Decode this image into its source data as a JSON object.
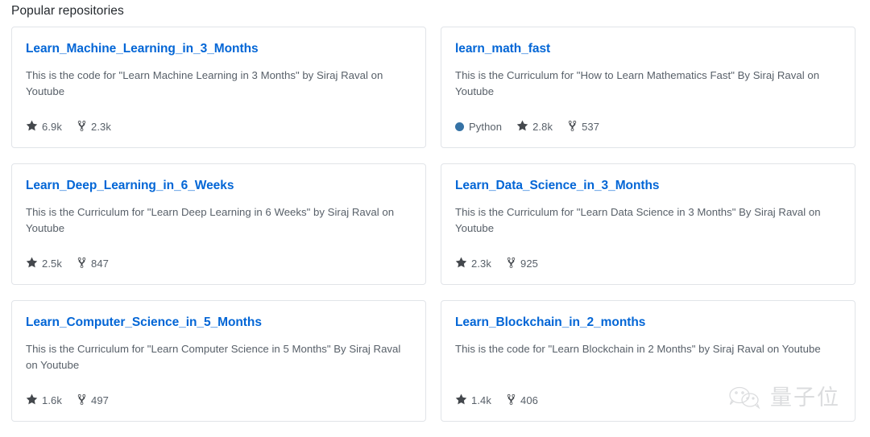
{
  "section": {
    "title": "Popular repositories"
  },
  "colors": {
    "link": "#0366d6",
    "text_muted": "#586069",
    "card_border": "#e1e4e8",
    "python_dot": "#3572A5",
    "watermark": "#8a8f94"
  },
  "repositories": [
    {
      "name": "Learn_Machine_Learning_in_3_Months",
      "description": "This is the code for \"Learn Machine Learning in 3 Months\" by Siraj Raval on Youtube",
      "language": null,
      "stars": "6.9k",
      "forks": "2.3k",
      "star_icon": "star-icon",
      "fork_icon": "repo-forked-icon"
    },
    {
      "name": "learn_math_fast",
      "description": "This is the Curriculum for \"How to Learn Mathematics Fast\" By Siraj Raval on Youtube",
      "language": "Python",
      "stars": "2.8k",
      "forks": "537",
      "star_icon": "star-icon",
      "fork_icon": "repo-forked-icon"
    },
    {
      "name": "Learn_Deep_Learning_in_6_Weeks",
      "description": "This is the Curriculum for \"Learn Deep Learning in 6 Weeks\" by Siraj Raval on Youtube",
      "language": null,
      "stars": "2.5k",
      "forks": "847",
      "star_icon": "star-icon",
      "fork_icon": "repo-forked-icon"
    },
    {
      "name": "Learn_Data_Science_in_3_Months",
      "description": "This is the Curriculum for \"Learn Data Science in 3 Months\" By Siraj Raval on Youtube",
      "language": null,
      "stars": "2.3k",
      "forks": "925",
      "star_icon": "star-icon",
      "fork_icon": "repo-forked-icon"
    },
    {
      "name": "Learn_Computer_Science_in_5_Months",
      "description": "This is the Curriculum for \"Learn Computer Science in 5 Months\" By Siraj Raval on Youtube",
      "language": null,
      "stars": "1.6k",
      "forks": "497",
      "star_icon": "star-icon",
      "fork_icon": "repo-forked-icon"
    },
    {
      "name": "Learn_Blockchain_in_2_months",
      "description": "This is the code for \"Learn Blockchain in 2 Months\" by Siraj Raval on Youtube",
      "language": null,
      "stars": "1.4k",
      "forks": "406",
      "star_icon": "star-icon",
      "fork_icon": "repo-forked-icon"
    }
  ],
  "watermark": {
    "icon": "wechat-icon",
    "text": "量子位"
  }
}
